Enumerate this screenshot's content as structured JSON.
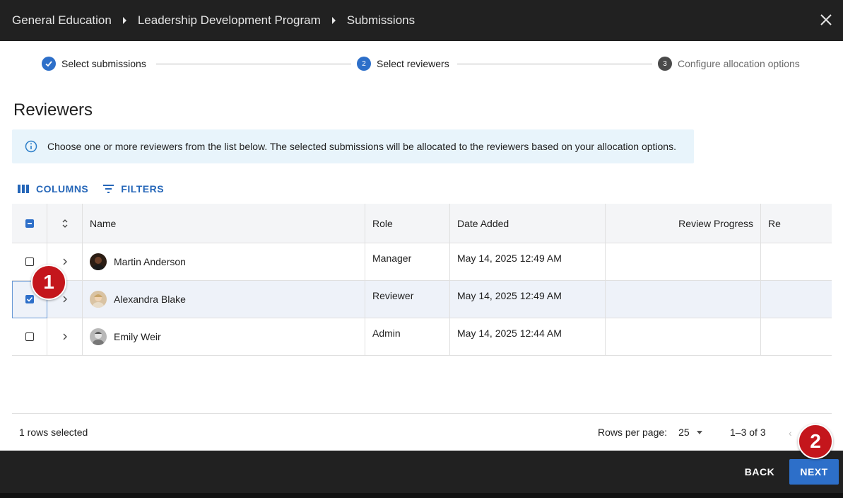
{
  "breadcrumb": [
    "General Education",
    "Leadership Development Program",
    "Submissions"
  ],
  "stepper": {
    "steps": [
      {
        "number": "1",
        "label": "Select submissions",
        "state": "done"
      },
      {
        "number": "2",
        "label": "Select reviewers",
        "state": "active"
      },
      {
        "number": "3",
        "label": "Configure allocation options",
        "state": "pending"
      }
    ]
  },
  "section_title": "Reviewers",
  "info_message": "Choose one or more reviewers from the list below. The selected submissions will be allocated to the reviewers based on your allocation options.",
  "toolbar": {
    "columns_label": "COLUMNS",
    "filters_label": "FILTERS"
  },
  "table": {
    "headers": {
      "name": "Name",
      "role": "Role",
      "date_added": "Date Added",
      "review_progress": "Review Progress",
      "extra": "Re"
    },
    "rows": [
      {
        "name": "Martin Anderson",
        "role": "Manager",
        "date_added": "May 14, 2025 12:49 AM",
        "selected": false
      },
      {
        "name": "Alexandra Blake",
        "role": "Reviewer",
        "date_added": "May 14, 2025 12:49 AM",
        "selected": true
      },
      {
        "name": "Emily Weir",
        "role": "Admin",
        "date_added": "May 14, 2025 12:44 AM",
        "selected": false
      }
    ]
  },
  "footer": {
    "rows_selected": "1 rows selected",
    "rows_per_page_label": "Rows per page:",
    "rows_per_page_value": "25",
    "range": "1–3 of 3",
    "prev_glyph": "‹"
  },
  "actions": {
    "back_label": "BACK",
    "next_label": "NEXT"
  },
  "annotations": [
    "1",
    "2"
  ],
  "colors": {
    "accent": "#2d6fc9",
    "header_bg": "#212121",
    "info_bg": "#e8f4fb",
    "badge": "#c4161c"
  }
}
